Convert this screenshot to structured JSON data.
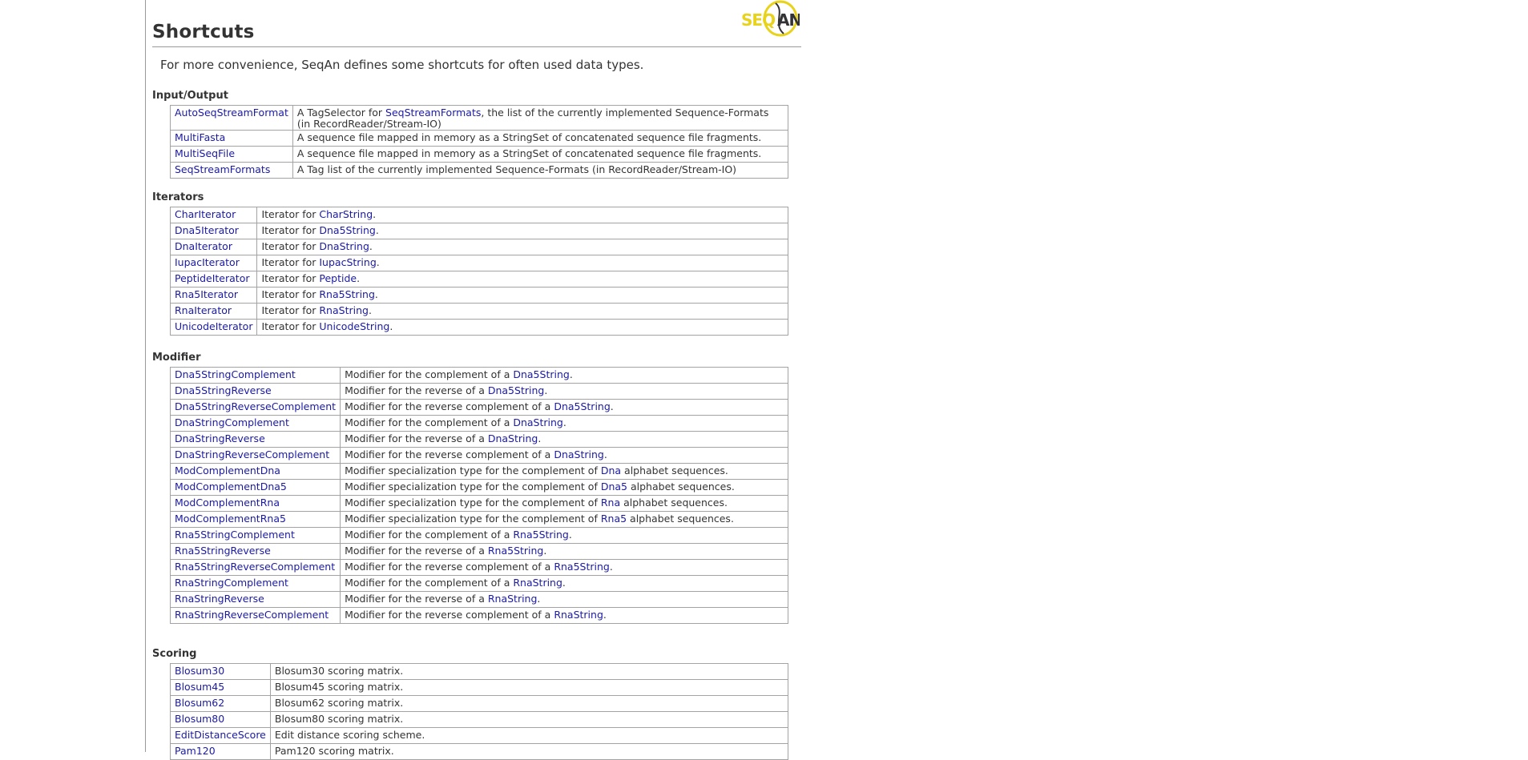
{
  "page": {
    "title": "Shortcuts",
    "intro": "For more convenience, SeqAn defines some shortcuts for often used data types.",
    "logo_text": "SEQAN",
    "colors": {
      "link": "#1a1aa6",
      "logo_yellow": "#e8d21a",
      "logo_dark": "#333333",
      "border": "#a3a3a3"
    }
  },
  "sections": [
    {
      "title": "Input/Output",
      "rows": [
        {
          "name": "AutoSeqStreamFormat",
          "desc": [
            {
              "t": "A TagSelector for "
            },
            {
              "l": "SeqStreamFormats"
            },
            {
              "t": ", the list of the currently implemented Sequence-Formats (in RecordReader/Stream-IO)"
            }
          ]
        },
        {
          "name": "MultiFasta",
          "desc": [
            {
              "t": "A sequence file mapped in memory as a StringSet of concatenated sequence file fragments."
            }
          ]
        },
        {
          "name": "MultiSeqFile",
          "desc": [
            {
              "t": "A sequence file mapped in memory as a StringSet of concatenated sequence file fragments."
            }
          ]
        },
        {
          "name": "SeqStreamFormats",
          "desc": [
            {
              "t": "A Tag list of the currently implemented Sequence-Formats (in RecordReader/Stream-IO)"
            }
          ]
        }
      ]
    },
    {
      "title": "Iterators",
      "rows": [
        {
          "name": "CharIterator",
          "desc": [
            {
              "t": "Iterator for "
            },
            {
              "l": "CharString"
            },
            {
              "t": "."
            }
          ]
        },
        {
          "name": "Dna5Iterator",
          "desc": [
            {
              "t": "Iterator for "
            },
            {
              "l": "Dna5String"
            },
            {
              "t": "."
            }
          ]
        },
        {
          "name": "DnaIterator",
          "desc": [
            {
              "t": "Iterator for "
            },
            {
              "l": "DnaString"
            },
            {
              "t": "."
            }
          ]
        },
        {
          "name": "IupacIterator",
          "desc": [
            {
              "t": "Iterator for "
            },
            {
              "l": "IupacString"
            },
            {
              "t": "."
            }
          ]
        },
        {
          "name": "PeptideIterator",
          "desc": [
            {
              "t": "Iterator for "
            },
            {
              "l": "Peptide"
            },
            {
              "t": "."
            }
          ]
        },
        {
          "name": "Rna5Iterator",
          "desc": [
            {
              "t": "Iterator for "
            },
            {
              "l": "Rna5String"
            },
            {
              "t": "."
            }
          ]
        },
        {
          "name": "RnaIterator",
          "desc": [
            {
              "t": "Iterator for "
            },
            {
              "l": "RnaString"
            },
            {
              "t": "."
            }
          ]
        },
        {
          "name": "UnicodeIterator",
          "desc": [
            {
              "t": "Iterator for "
            },
            {
              "l": "UnicodeString"
            },
            {
              "t": "."
            }
          ]
        }
      ]
    },
    {
      "title": "Modifier",
      "rows": [
        {
          "name": "Dna5StringComplement",
          "desc": [
            {
              "t": "Modifier for the complement of a "
            },
            {
              "l": "Dna5String"
            },
            {
              "t": "."
            }
          ]
        },
        {
          "name": "Dna5StringReverse",
          "desc": [
            {
              "t": "Modifier for the reverse of a "
            },
            {
              "l": "Dna5String"
            },
            {
              "t": "."
            }
          ]
        },
        {
          "name": "Dna5StringReverseComplement",
          "desc": [
            {
              "t": "Modifier for the reverse complement of a "
            },
            {
              "l": "Dna5String"
            },
            {
              "t": "."
            }
          ]
        },
        {
          "name": "DnaStringComplement",
          "desc": [
            {
              "t": "Modifier for the complement of a "
            },
            {
              "l": "DnaString"
            },
            {
              "t": "."
            }
          ]
        },
        {
          "name": "DnaStringReverse",
          "desc": [
            {
              "t": "Modifier for the reverse of a "
            },
            {
              "l": "DnaString"
            },
            {
              "t": "."
            }
          ]
        },
        {
          "name": "DnaStringReverseComplement",
          "desc": [
            {
              "t": "Modifier for the reverse complement of a "
            },
            {
              "l": "DnaString"
            },
            {
              "t": "."
            }
          ]
        },
        {
          "name": "ModComplementDna",
          "desc": [
            {
              "t": "Modifier specialization type for the complement of "
            },
            {
              "l": "Dna"
            },
            {
              "t": " alphabet sequences."
            }
          ]
        },
        {
          "name": "ModComplementDna5",
          "desc": [
            {
              "t": "Modifier specialization type for the complement of "
            },
            {
              "l": "Dna5"
            },
            {
              "t": " alphabet sequences."
            }
          ]
        },
        {
          "name": "ModComplementRna",
          "desc": [
            {
              "t": "Modifier specialization type for the complement of "
            },
            {
              "l": "Rna"
            },
            {
              "t": " alphabet sequences."
            }
          ]
        },
        {
          "name": "ModComplementRna5",
          "desc": [
            {
              "t": "Modifier specialization type for the complement of "
            },
            {
              "l": "Rna5"
            },
            {
              "t": " alphabet sequences."
            }
          ]
        },
        {
          "name": "Rna5StringComplement",
          "desc": [
            {
              "t": "Modifier for the complement of a "
            },
            {
              "l": "Rna5String"
            },
            {
              "t": "."
            }
          ]
        },
        {
          "name": "Rna5StringReverse",
          "desc": [
            {
              "t": "Modifier for the reverse of a "
            },
            {
              "l": "Rna5String"
            },
            {
              "t": "."
            }
          ]
        },
        {
          "name": "Rna5StringReverseComplement",
          "desc": [
            {
              "t": "Modifier for the reverse complement of a "
            },
            {
              "l": "Rna5String"
            },
            {
              "t": "."
            }
          ]
        },
        {
          "name": "RnaStringComplement",
          "desc": [
            {
              "t": "Modifier for the complement of a "
            },
            {
              "l": "RnaString"
            },
            {
              "t": "."
            }
          ]
        },
        {
          "name": "RnaStringReverse",
          "desc": [
            {
              "t": "Modifier for the reverse of a "
            },
            {
              "l": "RnaString"
            },
            {
              "t": "."
            }
          ]
        },
        {
          "name": "RnaStringReverseComplement",
          "desc": [
            {
              "t": "Modifier for the reverse complement of a "
            },
            {
              "l": "RnaString"
            },
            {
              "t": "."
            }
          ]
        }
      ]
    },
    {
      "title": "Scoring",
      "rows": [
        {
          "name": "Blosum30",
          "desc": [
            {
              "t": "Blosum30 scoring matrix."
            }
          ]
        },
        {
          "name": "Blosum45",
          "desc": [
            {
              "t": "Blosum45 scoring matrix."
            }
          ]
        },
        {
          "name": "Blosum62",
          "desc": [
            {
              "t": "Blosum62 scoring matrix."
            }
          ]
        },
        {
          "name": "Blosum80",
          "desc": [
            {
              "t": "Blosum80 scoring matrix."
            }
          ]
        },
        {
          "name": "EditDistanceScore",
          "desc": [
            {
              "t": "Edit distance scoring scheme."
            }
          ]
        },
        {
          "name": "Pam120",
          "desc": [
            {
              "t": "Pam120 scoring matrix."
            }
          ]
        }
      ]
    }
  ]
}
